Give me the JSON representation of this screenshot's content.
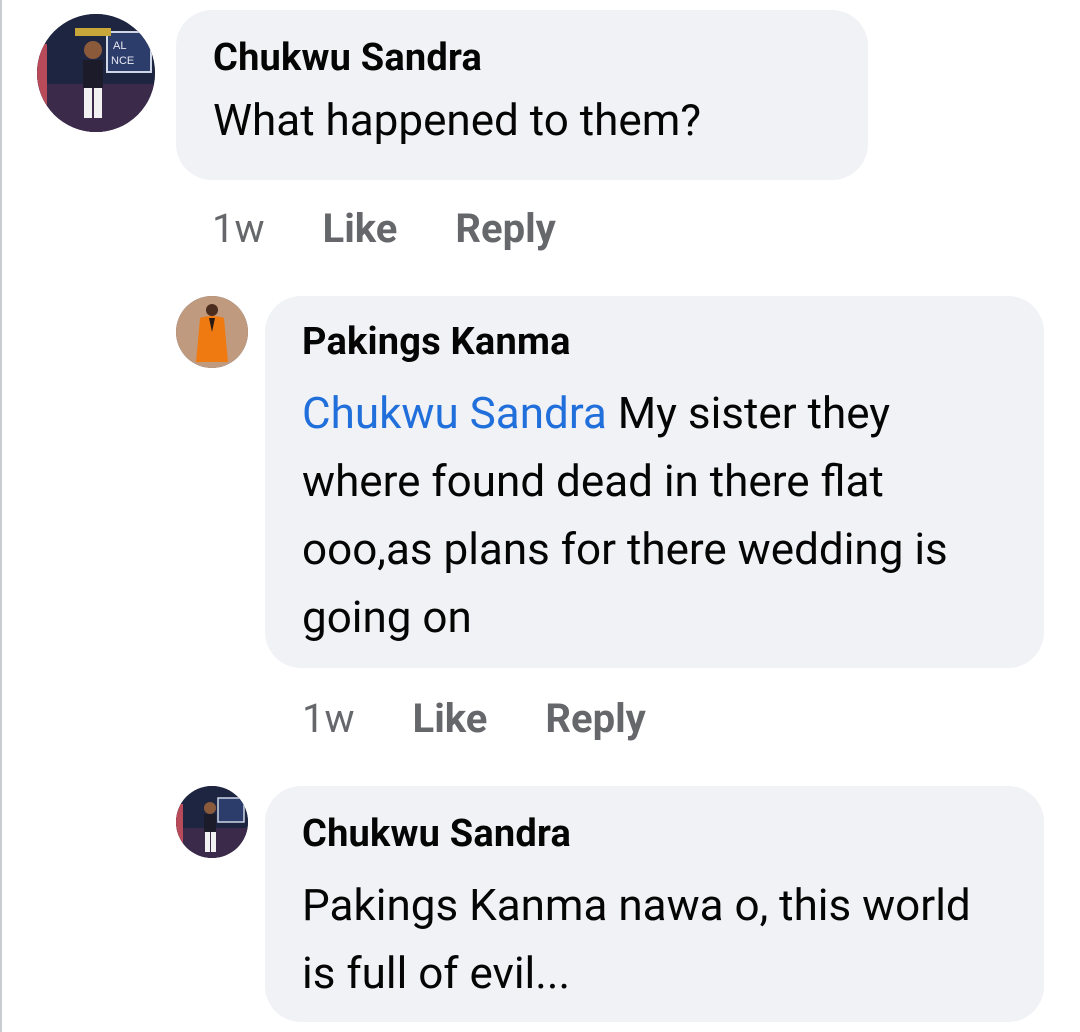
{
  "comments": [
    {
      "author": "Chukwu Sandra",
      "mention": "",
      "text": "What happened to them?",
      "time": "1w",
      "like_label": "Like",
      "reply_label": "Reply",
      "avatar_icon": "profile-photo-woman-stage-icon"
    },
    {
      "author": "Pakings Kanma",
      "mention": "Chukwu Sandra",
      "text": "My sister they where found dead in there flat ooo,as plans for there wedding is going on",
      "time": "1w",
      "like_label": "Like",
      "reply_label": "Reply",
      "avatar_icon": "profile-photo-man-orange-attire-icon"
    },
    {
      "author": "Chukwu Sandra",
      "mention": "",
      "text": "Pakings Kanma nawa o, this world is full of evil...",
      "avatar_icon": "profile-photo-woman-stage-icon"
    }
  ],
  "colors": {
    "bubble": "#f0f2f5",
    "mention": "#216fdb",
    "meta": "#65676b"
  }
}
